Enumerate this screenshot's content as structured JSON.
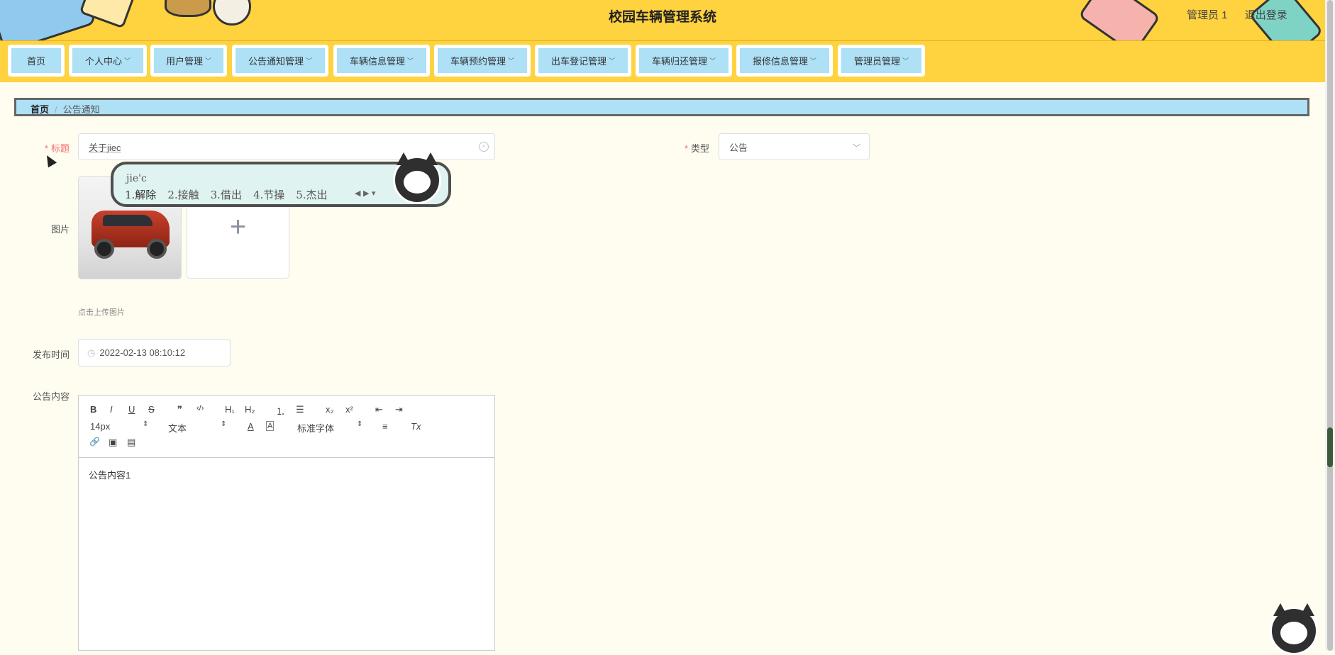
{
  "header": {
    "title": "校园车辆管理系统",
    "user": "管理员 1",
    "logout": "退出登录"
  },
  "nav": [
    {
      "label": "首页",
      "has_menu": false
    },
    {
      "label": "个人中心",
      "has_menu": true
    },
    {
      "label": "用户管理",
      "has_menu": true
    },
    {
      "label": "公告通知管理",
      "has_menu": true
    },
    {
      "label": "车辆信息管理",
      "has_menu": true
    },
    {
      "label": "车辆预约管理",
      "has_menu": true
    },
    {
      "label": "出车登记管理",
      "has_menu": true
    },
    {
      "label": "车辆归还管理",
      "has_menu": true
    },
    {
      "label": "报修信息管理",
      "has_menu": true
    },
    {
      "label": "管理员管理",
      "has_menu": true
    }
  ],
  "breadcrumb": {
    "home": "首页",
    "separator": "/",
    "current": "公告通知"
  },
  "form": {
    "title_label": "标题",
    "title_value": "关于jiec",
    "type_label": "类型",
    "type_value": "公告",
    "image_label": "图片",
    "upload_hint": "点击上传图片",
    "upload_plus": "+",
    "time_label": "发布时间",
    "time_value": "2022-02-13 08:10:12",
    "content_label": "公告内容"
  },
  "editor": {
    "toolbar": {
      "bold": "B",
      "italic": "I",
      "underline": "U",
      "strike": "S",
      "quote": "❞",
      "code": "‹/›",
      "h1": "H₁",
      "h2": "H₂",
      "ordered": "⒈",
      "bullet": "☰",
      "sub": "x₂",
      "sup": "x²",
      "outdent": "⇤",
      "indent": "⇥",
      "size": "14px",
      "header": "文本",
      "font": "标准字体",
      "color": "A",
      "bg": "A",
      "align": "≡",
      "clean": "Tx",
      "link": "🔗",
      "image": "▣",
      "video": "▤"
    },
    "content": "公告内容1"
  },
  "ime": {
    "pinyin": "jie'c",
    "candidates": [
      "1.解除",
      "2.接触",
      "3.借出",
      "4.节操",
      "5.杰出"
    ]
  }
}
